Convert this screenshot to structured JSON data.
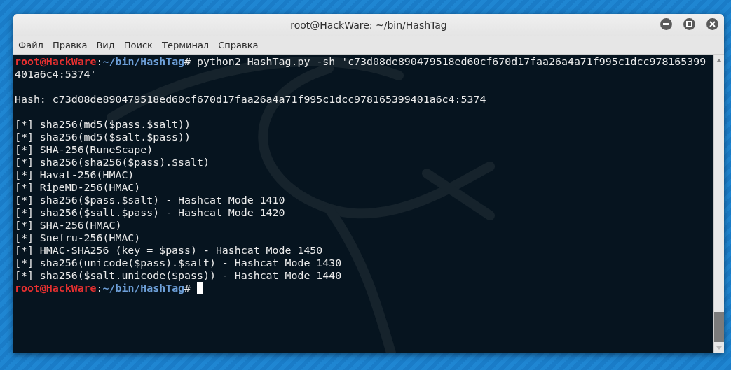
{
  "window": {
    "title": "root@HackWare: ~/bin/HashTag"
  },
  "menu": [
    "Файл",
    "Правка",
    "Вид",
    "Поиск",
    "Терминал",
    "Справка"
  ],
  "terminal": {
    "lines": [
      {
        "kind": "prompt",
        "user": "root@HackWare",
        "sep": ":",
        "path": "~/bin/HashTag",
        "mark": "#",
        "command": "python2 HashTag.py -sh 'c73d08de890479518ed60cf670d17faa26a4a71f995c1dcc978165399",
        "cursor": false
      },
      {
        "kind": "output",
        "text": "401a6c4:5374'"
      },
      {
        "kind": "blank"
      },
      {
        "kind": "output",
        "text": "Hash: c73d08de890479518ed60cf670d17faa26a4a71f995c1dcc978165399401a6c4:5374"
      },
      {
        "kind": "blank"
      },
      {
        "kind": "output",
        "text": "[*] sha256(md5($pass.$salt))"
      },
      {
        "kind": "output",
        "text": "[*] sha256(md5($salt.$pass))"
      },
      {
        "kind": "output",
        "text": "[*] SHA-256(RuneScape)"
      },
      {
        "kind": "output",
        "text": "[*] sha256(sha256($pass).$salt)"
      },
      {
        "kind": "output",
        "text": "[*] Haval-256(HMAC)"
      },
      {
        "kind": "output",
        "text": "[*] RipeMD-256(HMAC)"
      },
      {
        "kind": "output",
        "text": "[*] sha256($pass.$salt) - Hashcat Mode 1410"
      },
      {
        "kind": "output",
        "text": "[*] sha256($salt.$pass) - Hashcat Mode 1420"
      },
      {
        "kind": "output",
        "text": "[*] SHA-256(HMAC)"
      },
      {
        "kind": "output",
        "text": "[*] Snefru-256(HMAC)"
      },
      {
        "kind": "output",
        "text": "[*] HMAC-SHA256 (key = $pass) - Hashcat Mode 1450"
      },
      {
        "kind": "output",
        "text": "[*] sha256(unicode($pass).$salt) - Hashcat Mode 1430"
      },
      {
        "kind": "output",
        "text": "[*] sha256($salt.unicode($pass)) - Hashcat Mode 1440"
      },
      {
        "kind": "prompt",
        "user": "root@HackWare",
        "sep": ":",
        "path": "~/bin/HashTag",
        "mark": "#",
        "cursor": true
      }
    ]
  }
}
